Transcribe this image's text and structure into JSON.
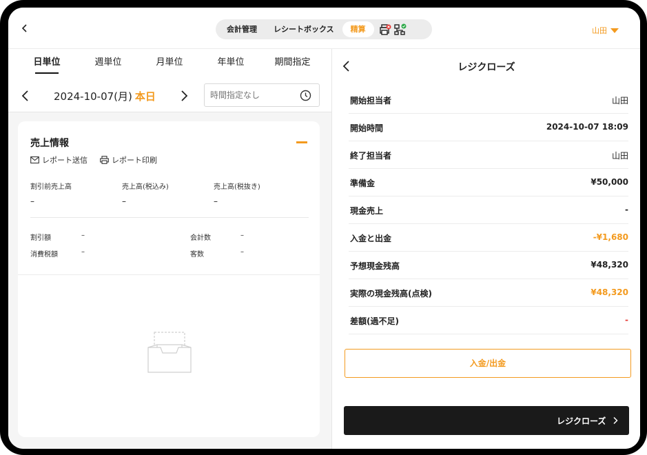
{
  "header": {
    "tabs": [
      {
        "label": "会計管理",
        "active": false
      },
      {
        "label": "レシートボックス",
        "active": false
      },
      {
        "label": "精算",
        "active": true
      }
    ],
    "icons": [
      "printer-error-icon",
      "network-ok-icon"
    ],
    "user": "山田",
    "accent_color": "#f39a1e"
  },
  "left": {
    "period_tabs": [
      {
        "label": "日単位",
        "active": true
      },
      {
        "label": "週単位",
        "active": false
      },
      {
        "label": "月単位",
        "active": false
      },
      {
        "label": "年単位",
        "active": false
      },
      {
        "label": "期間指定",
        "active": false
      }
    ],
    "date": "2024-10-07(月)",
    "today_label": "本日",
    "time_placeholder": "時間指定なし",
    "sales": {
      "title": "売上情報",
      "send_report": "レポート送信",
      "print_report": "レポート印刷",
      "metrics": [
        {
          "label": "割引前売上高",
          "value": "–"
        },
        {
          "label": "売上高(税込み)",
          "value": "–"
        },
        {
          "label": "売上高(税抜き)",
          "value": "–"
        }
      ],
      "discount_label": "割引額",
      "discount_value": "–",
      "tax_label": "消費税額",
      "tax_value": "–",
      "tx_count_label": "会計数",
      "tx_count_value": "–",
      "customers_label": "客数",
      "customers_value": "–"
    }
  },
  "right": {
    "title": "レジクローズ",
    "rows": [
      {
        "label": "開始担当者",
        "value": "山田",
        "style": "normal"
      },
      {
        "label": "開始時間",
        "value": "2024-10-07 18:09",
        "style": "bold"
      },
      {
        "label": "終了担当者",
        "value": "山田",
        "style": "normal"
      },
      {
        "label": "準備金",
        "value": "¥50,000",
        "style": "bold"
      },
      {
        "label": "現金売上",
        "value": "-",
        "style": "bold"
      },
      {
        "label": "入金と出金",
        "value": "-¥1,680",
        "style": "orange"
      },
      {
        "label": "予想現金残高",
        "value": "¥48,320",
        "style": "bold"
      },
      {
        "label": "実際の現金残高(点検)",
        "value": "¥48,320",
        "style": "orange"
      },
      {
        "label": "差額(過不足)",
        "value": "-",
        "style": "red"
      }
    ],
    "deposit_button": "入金/出金",
    "close_button": "レジクローズ"
  }
}
